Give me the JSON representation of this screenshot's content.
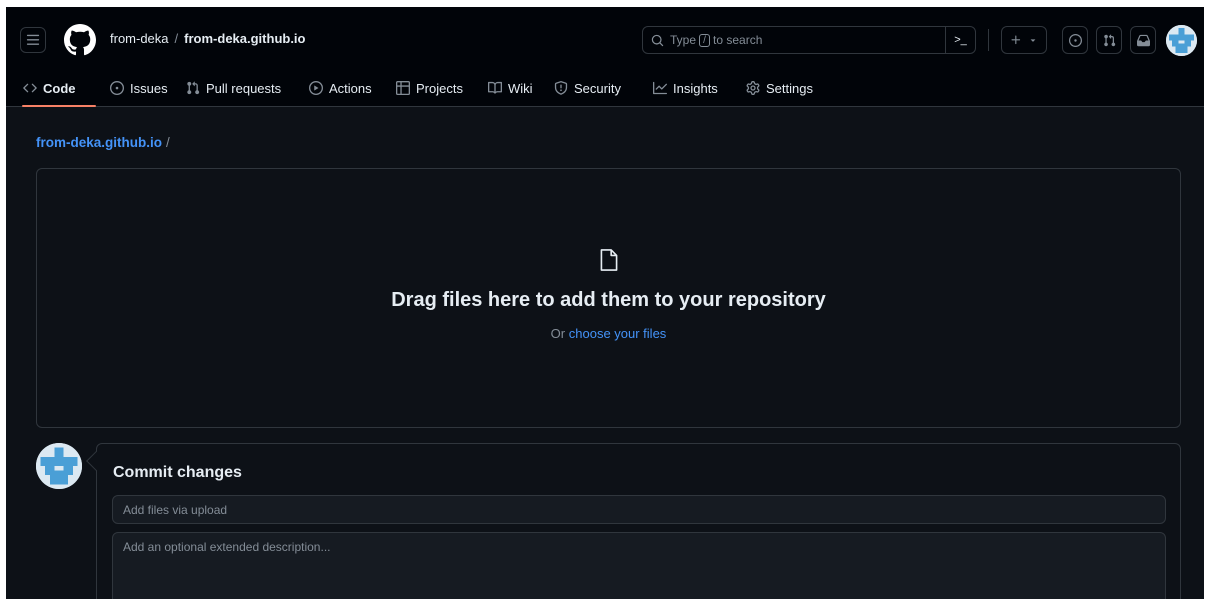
{
  "header": {
    "owner": "from-deka",
    "separator": "/",
    "repo": "from-deka.github.io",
    "search": {
      "prefix": "Type",
      "key": "/",
      "suffix": "to search",
      "cmd_icon": ">_"
    }
  },
  "nav": {
    "tabs": [
      {
        "label": "Code",
        "icon": "code-icon",
        "active": true
      },
      {
        "label": "Issues",
        "icon": "issue-icon"
      },
      {
        "label": "Pull requests",
        "icon": "pull-request-icon"
      },
      {
        "label": "Actions",
        "icon": "play-icon"
      },
      {
        "label": "Projects",
        "icon": "table-icon"
      },
      {
        "label": "Wiki",
        "icon": "book-icon"
      },
      {
        "label": "Security",
        "icon": "shield-icon"
      },
      {
        "label": "Insights",
        "icon": "graph-icon"
      },
      {
        "label": "Settings",
        "icon": "gear-icon"
      }
    ]
  },
  "breadcrumb": {
    "repo": "from-deka.github.io",
    "slash": "/"
  },
  "dropzone": {
    "title": "Drag files here to add them to your repository",
    "sub_prefix": "Or",
    "sub_link": "choose your files"
  },
  "commit": {
    "title": "Commit changes",
    "summary_placeholder": "Add files via upload",
    "description_placeholder": "Add an optional extended description..."
  },
  "colors": {
    "background": "#0d1117",
    "header": "#010409",
    "link": "#4493f8",
    "accent": "#f78166",
    "border": "#30363d"
  }
}
